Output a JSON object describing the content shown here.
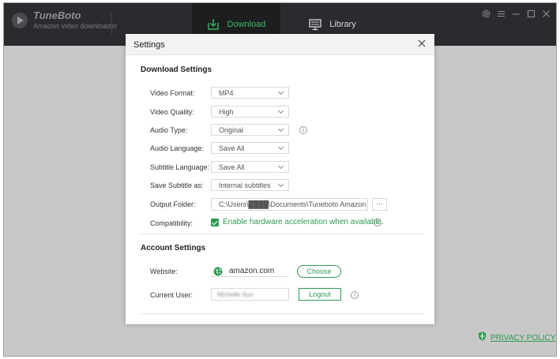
{
  "app": {
    "name": "TuneBoto",
    "subtitle": "Amazon video downloader"
  },
  "tabs": [
    {
      "label": "Download",
      "icon": "download-icon",
      "active": true
    },
    {
      "label": "Library",
      "icon": "monitor-icon",
      "active": false
    }
  ],
  "window_controls": [
    "gear-icon",
    "menu-icon",
    "minimize-icon",
    "maximize-icon",
    "close-icon"
  ],
  "privacy": {
    "label": "PRIVACY POLICY"
  },
  "dialog": {
    "title": "Settings",
    "download_section": {
      "title": "Download Settings",
      "video_format": {
        "label": "Video Format:",
        "value": "MP4"
      },
      "video_quality": {
        "label": "Video Quality:",
        "value": "High"
      },
      "audio_type": {
        "label": "Audio Type:",
        "value": "Original"
      },
      "audio_language": {
        "label": "Audio Language:",
        "value": "Save All"
      },
      "subtitle_language": {
        "label": "Subtitle Language:",
        "value": "Save All"
      },
      "save_subtitle": {
        "label": "Save Subtitle as:",
        "value": "Internal subtitles"
      },
      "output_folder": {
        "label": "Output Folder:",
        "value": "C:\\Users\\████\\Documents\\Tuneboto Amazon",
        "button": "···"
      },
      "compatibility": {
        "label": "Compatibility:",
        "checkbox_label": "Enable hardware acceleration when available.",
        "checked": true
      }
    },
    "account_section": {
      "title": "Account Settings",
      "website": {
        "label": "Website:",
        "value": "amazon.com",
        "button": "Choose"
      },
      "current_user": {
        "label": "Current User:",
        "value": "Michelle Sun",
        "button": "Logout"
      }
    }
  },
  "colors": {
    "accent": "#2e9a52",
    "titlebar": "#2a2b2e",
    "backdrop": "#c8c8c8"
  }
}
